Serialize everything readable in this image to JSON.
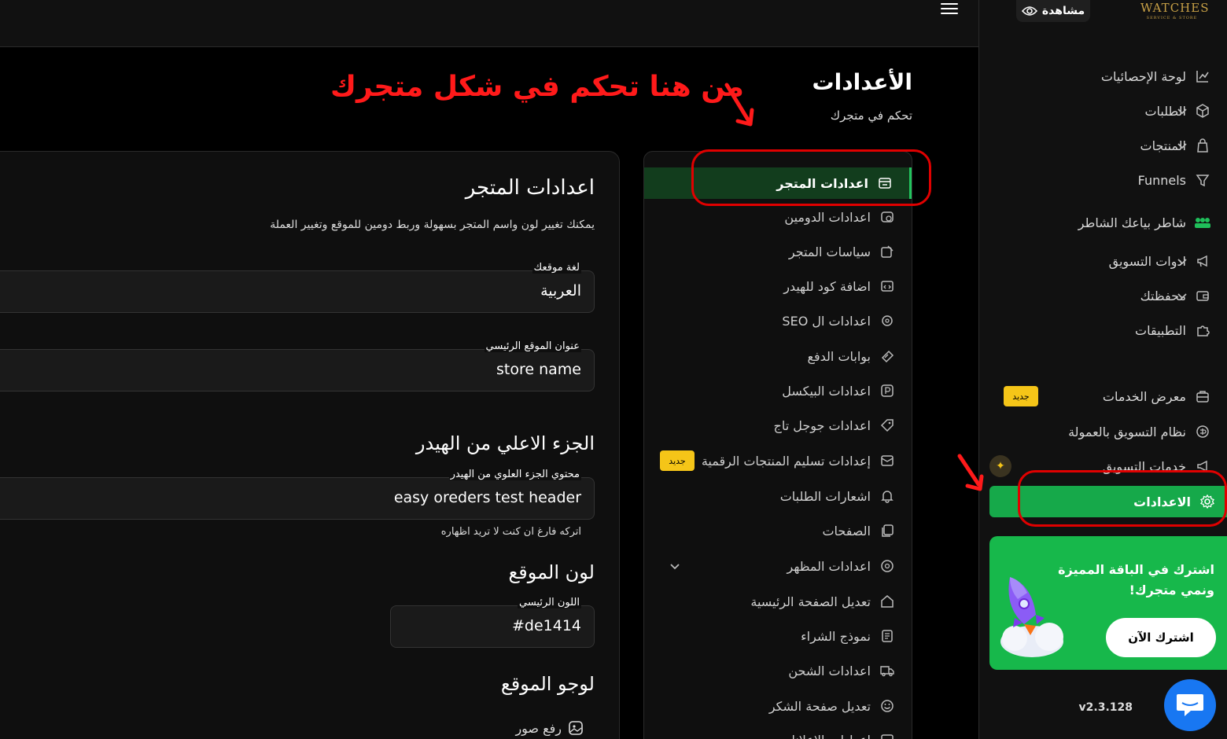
{
  "sidebar": {
    "logo_text": "WATCHES",
    "logo_sub": "SERVICE & STORE",
    "view_label": "مشاهدة",
    "items": [
      {
        "label": "لوحة الإحصائيات",
        "icon": "chart-icon"
      },
      {
        "label": "الطلبات",
        "icon": "box-icon"
      },
      {
        "label": "المنتجات",
        "icon": "bag-icon"
      },
      {
        "label": "Funnels",
        "icon": "funnel-icon"
      },
      {
        "label": "شاطر بياعك الشاطر",
        "icon": "group-icon"
      },
      {
        "label": "ادوات التسويق",
        "icon": "megaphone-icon"
      },
      {
        "label": "محفظتك",
        "icon": "wallet-icon"
      },
      {
        "label": "التطبيقات",
        "icon": "puzzle-icon"
      },
      {
        "label": "معرض الخدمات",
        "icon": "services-icon"
      },
      {
        "label": "نظام التسويق بالعمولة",
        "icon": "affiliate-icon"
      },
      {
        "label": "خدمات التسويق",
        "icon": "marketing-icon"
      }
    ],
    "new_badge": "جديد",
    "active_label": "الاعدادات",
    "promo_title": "اشترك في الباقة المميزة ونمي متجرك!",
    "promo_button": "اشترك الآن",
    "version": "v2.3.128"
  },
  "header": {
    "page_title": "الأعدادات",
    "page_subtitle": "تحكم في متجرك",
    "annotation": "من هنا تحكم في شكل متجرك"
  },
  "settings_menu": {
    "items": [
      {
        "label": "اعدادات المتجر",
        "icon": "store-icon"
      },
      {
        "label": "اعدادات الدومين",
        "icon": "domain-icon"
      },
      {
        "label": "سياسات المتجر",
        "icon": "policy-icon"
      },
      {
        "label": "اضافة كود للهيدر",
        "icon": "code-icon"
      },
      {
        "label": "اعدادات ال SEO",
        "icon": "seo-icon"
      },
      {
        "label": "بوابات الدفع",
        "icon": "payment-icon"
      },
      {
        "label": "اعدادات البيكسل",
        "icon": "pixel-icon"
      },
      {
        "label": "اعدادات جوجل تاج",
        "icon": "tag-icon"
      },
      {
        "label": "إعدادات تسليم المنتجات الرقمية",
        "icon": "digital-icon"
      },
      {
        "label": "اشعارات الطلبات",
        "icon": "bell-icon"
      },
      {
        "label": "الصفحات",
        "icon": "pages-icon"
      },
      {
        "label": "اعدادات المظهر",
        "icon": "palette-icon"
      },
      {
        "label": "تعديل الصفحة الرئيسية",
        "icon": "home-icon"
      },
      {
        "label": "نموذج الشراء",
        "icon": "form-icon"
      },
      {
        "label": "اعدادات الشحن",
        "icon": "truck-icon"
      },
      {
        "label": "تعديل صفحة الشكر",
        "icon": "smile-icon"
      },
      {
        "label": "اعدادات الاعلانات",
        "icon": "ads-icon"
      }
    ],
    "new_badge": "جديد"
  },
  "form": {
    "title": "اعدادات المتجر",
    "description": "يمكنك تغيير لون واسم المتجر بسهولة وربط دومين للموقع وتغيير العملة",
    "language_label": "لغة موقعك",
    "language_value": "العربية",
    "site_title_label": "عنوان الموقع الرئيسي",
    "site_title_value": "store name",
    "header_section_title": "الجزء الاعلي من الهيدر",
    "header_content_label": "محتوي الجزء العلوي من الهيدر",
    "header_content_value": "easy oreders test header",
    "header_hint": "اتركه فارغ ان كنت لا تريد اظهاره",
    "color_section_title": "لون الموقع",
    "primary_color_label": "اللون الرئيسي",
    "primary_color_value": "#de1414",
    "logo_section_title": "لوجو الموقع",
    "upload_label": "رفع صور"
  },
  "colors": {
    "accent": "#16a94a",
    "annotation": "#e00000",
    "badge": "#f5c518"
  }
}
